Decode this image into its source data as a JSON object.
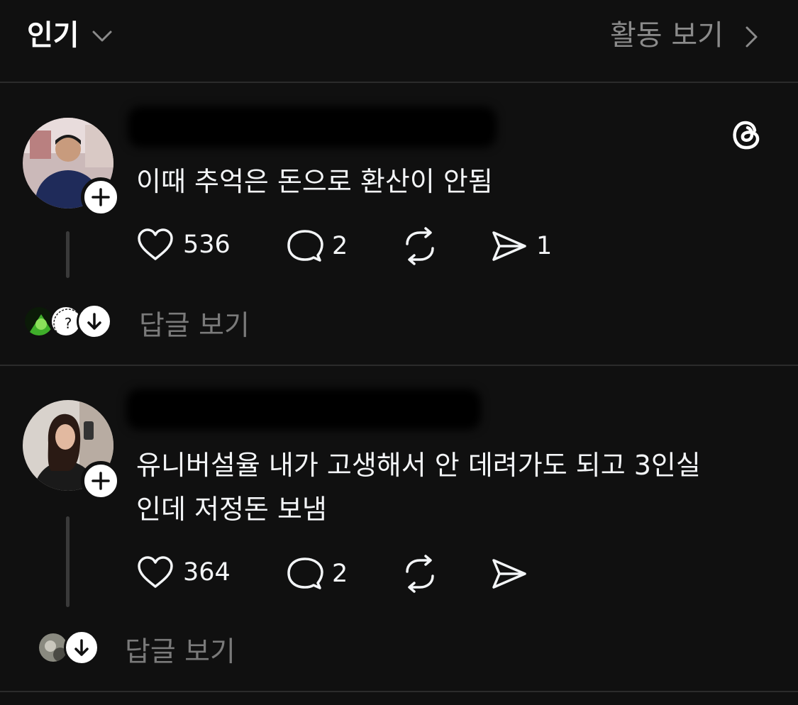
{
  "header": {
    "title": "인기",
    "activity_link": "활동 보기"
  },
  "posts": [
    {
      "text": "이때 추억은 돈으로 환산이 안됨",
      "likes": "536",
      "comments": "2",
      "shares": "1",
      "replies_link": "답글 보기"
    },
    {
      "text_line1": "유니버설율 내가 고생해서  안 데려가도 되고 3인실",
      "text_line2": "인데 저정돈 보냄",
      "likes": "364",
      "comments": "2",
      "replies_link": "답글 보기"
    }
  ],
  "icons": {
    "header_dropdown": "chevron-down-icon",
    "activity": "chevron-right-icon",
    "app": "threads-logo-icon",
    "like": "heart-icon",
    "comment": "comment-bubble-icon",
    "repost": "repost-icon",
    "share": "send-icon",
    "follow": "plus-icon",
    "expand": "arrow-down-icon"
  }
}
